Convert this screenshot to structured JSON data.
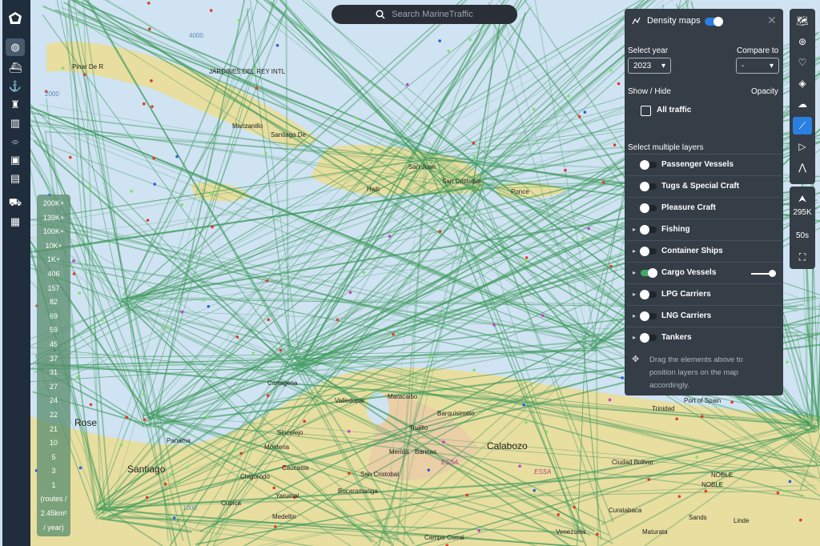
{
  "search": {
    "placeholder": "Search MarineTraffic",
    "icon": "search-icon"
  },
  "left_toolbar": {
    "icons": [
      "logo-icon",
      "globe-icon",
      "ship-icon",
      "anchor-icon",
      "lighthouse-icon",
      "buildings-icon",
      "antenna-icon",
      "photos-icon",
      "news-icon",
      "ship-ownership-icon",
      "containers-icon"
    ],
    "active": "globe-icon"
  },
  "density_panel": {
    "title": "Density maps",
    "enabled": true,
    "select_year_label": "Select year",
    "year_value": "2023",
    "compare_label": "Compare to",
    "compare_value": "-",
    "show_hide_label": "Show / Hide",
    "opacity_label": "Opacity",
    "all_traffic_label": "All traffic",
    "all_traffic_checked": false,
    "multiple_layers_label": "Select multiple layers",
    "layers": [
      {
        "label": "Passenger Vessels",
        "expandable": false,
        "on": false
      },
      {
        "label": "Tugs & Special Craft",
        "expandable": false,
        "on": false
      },
      {
        "label": "Pleasure Craft",
        "expandable": false,
        "on": false
      },
      {
        "label": "Fishing",
        "expandable": true,
        "on": false
      },
      {
        "label": "Container Ships",
        "expandable": true,
        "on": false
      },
      {
        "label": "Cargo Vessels",
        "expandable": true,
        "on": true,
        "opacity": 1.0
      },
      {
        "label": "LPG Carriers",
        "expandable": true,
        "on": false
      },
      {
        "label": "LNG Carriers",
        "expandable": true,
        "on": false
      },
      {
        "label": "Tankers",
        "expandable": true,
        "on": false
      }
    ],
    "hint": "Drag the elements above to position layers on the map accordingly."
  },
  "right_toolbar": {
    "icons": [
      "map-icon",
      "filter-icon",
      "heart-icon",
      "layers-icon",
      "weather-icon",
      "density-icon",
      "play-icon",
      "route-icon"
    ],
    "active": "density-icon",
    "north_icon": "north-arrow-icon",
    "scale_text": "295K",
    "time_text": "50s",
    "fullscreen_icon": "fullscreen-icon"
  },
  "legend": {
    "values": [
      "200K+",
      "139K+",
      "100K+",
      "10K+",
      "1K+",
      "406",
      "157",
      "82",
      "69",
      "59",
      "45",
      "37",
      "31",
      "27",
      "24",
      "22",
      "21",
      "10",
      "5",
      "3",
      "1"
    ],
    "unit_lines": [
      "(routes /",
      "2.45km²",
      "/ year)"
    ]
  },
  "map_labels": [
    "San Juan",
    "San Cristobal",
    "Haiti",
    "Ponce",
    "Manzanillo",
    "Santiago De",
    "Pinar De R",
    "JARDINES DEL REY INTL",
    "Cartagena",
    "Valledupar",
    "Maracaibo",
    "Barquisimeto",
    "Calabozo",
    "Barinas",
    "Merida",
    "Trujillo",
    "Sincelejo",
    "Monteria",
    "Caucasia",
    "Chigorodo",
    "Yarumal",
    "Bucaramanga",
    "San Cristobal",
    "Medellin",
    "Cupica",
    "Panama",
    "Santiago",
    "Rose",
    "Campo Corral",
    "Venezuela",
    "Curatabaca",
    "Sands",
    "Maturata",
    "Ciudad Bolivar",
    "ESSA",
    "ESSA",
    "NOBLE",
    "NOBLE",
    "Linde",
    "Trinidad",
    "Port of Spain",
    "2000",
    "1000",
    "4000"
  ],
  "colors": {
    "route_green": "#3f9a5c",
    "land": "#e8dea0",
    "water": "#cfe3f3",
    "panel_bg": "#353d47",
    "accent": "#2b7fe0"
  }
}
